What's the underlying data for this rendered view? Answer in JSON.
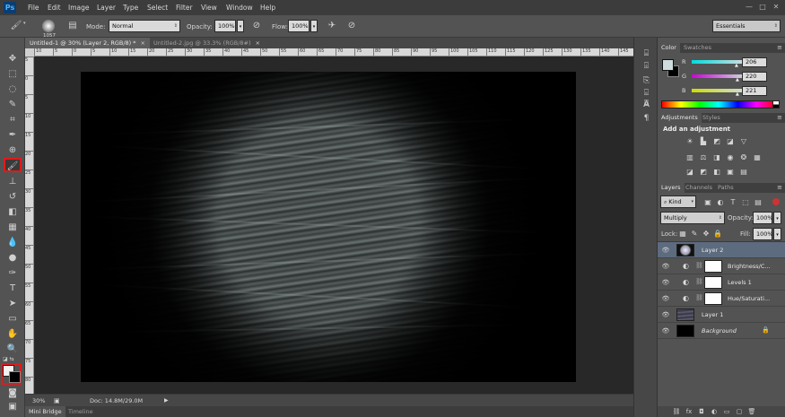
{
  "app": {
    "logo": "Ps"
  },
  "menu": [
    "File",
    "Edit",
    "Image",
    "Layer",
    "Type",
    "Select",
    "Filter",
    "View",
    "Window",
    "Help"
  ],
  "window_controls": [
    "—",
    "□",
    "✕"
  ],
  "options": {
    "brush_size": "1057",
    "mode_label": "Mode:",
    "mode_value": "Normal",
    "opacity_label": "Opacity:",
    "opacity_value": "100%",
    "flow_label": "Flow:",
    "flow_value": "100%",
    "workspace": "Essentials"
  },
  "doc_tabs": [
    {
      "label": "Untitled-1 @ 30% (Layer 2, RGB/8) *",
      "close": "×"
    },
    {
      "label": "Untitled-2.jpg @ 33.3% (RGB/8#)",
      "close": "×"
    }
  ],
  "ruler_h": [
    "10",
    "5",
    "0",
    "5",
    "10",
    "15",
    "20",
    "25",
    "30",
    "35",
    "40",
    "45",
    "50",
    "55",
    "60",
    "65",
    "70",
    "75",
    "80",
    "85",
    "90",
    "95",
    "100",
    "105",
    "110",
    "115",
    "120",
    "125",
    "130",
    "135",
    "140",
    "145"
  ],
  "ruler_v": [
    "5",
    "0",
    "5",
    "10",
    "15",
    "20",
    "25",
    "30",
    "35",
    "40",
    "45",
    "50",
    "55",
    "60",
    "65",
    "70",
    "75",
    "80"
  ],
  "status": {
    "zoom": "30%",
    "doc": "Doc: 14.8M/29.0M"
  },
  "bottom_tabs": [
    "Mini Bridge",
    "Timeline"
  ],
  "color_panel": {
    "tabs": [
      "Color",
      "Swatches"
    ],
    "channels": [
      {
        "label": "R",
        "value": "206"
      },
      {
        "label": "G",
        "value": "220"
      },
      {
        "label": "B",
        "value": "221"
      }
    ]
  },
  "adjustments_panel": {
    "tabs": [
      "Adjustments",
      "Styles"
    ],
    "title": "Add an adjustment"
  },
  "layers_panel": {
    "tabs": [
      "Layers",
      "Channels",
      "Paths"
    ],
    "kind": "Kind",
    "blend_mode": "Multiply",
    "opacity_label": "Opacity:",
    "opacity_value": "100%",
    "lock_label": "Lock:",
    "fill_label": "Fill:",
    "fill_value": "100%",
    "layers": [
      {
        "name": "Layer 2",
        "selected": true
      },
      {
        "name": "Brightness/C..."
      },
      {
        "name": "Levels 1"
      },
      {
        "name": "Hue/Saturati..."
      },
      {
        "name": "Layer 1"
      },
      {
        "name": "Background"
      }
    ]
  },
  "colors": {
    "highlight_red": "#e01b1b",
    "selection_blue": "#5d6b7e",
    "foreground": "#cedcdd"
  }
}
